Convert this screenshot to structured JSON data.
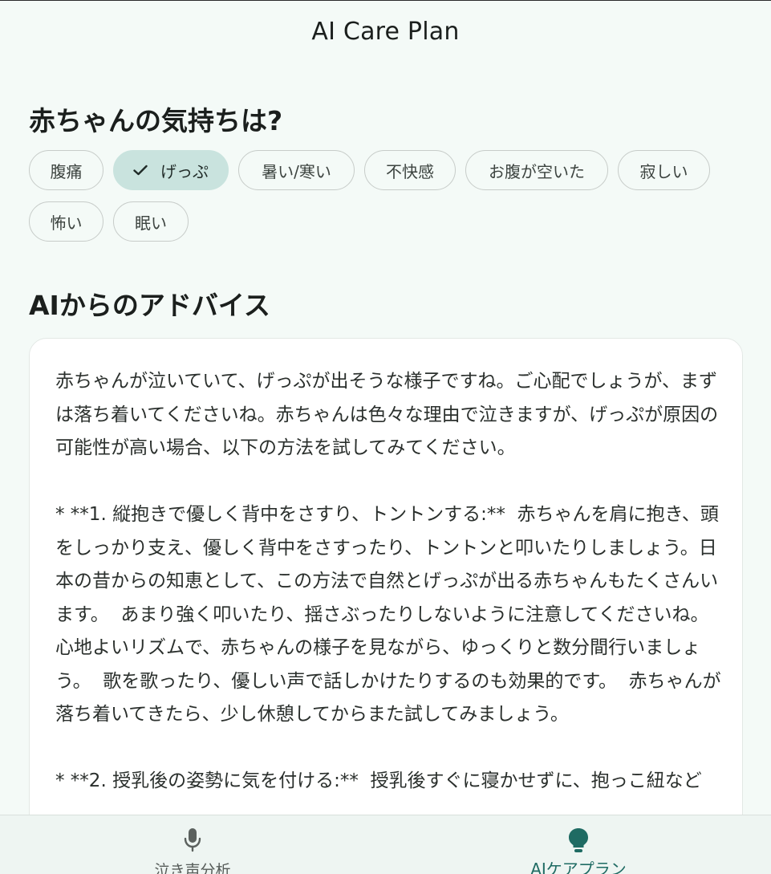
{
  "app": {
    "title": "AI Care Plan"
  },
  "feelings": {
    "title": "赤ちゃんの気持ちは?",
    "chips": [
      {
        "label": "腹痛",
        "selected": false
      },
      {
        "label": "げっぷ",
        "selected": true
      },
      {
        "label": "暑い/寒い",
        "selected": false
      },
      {
        "label": "不快感",
        "selected": false
      },
      {
        "label": "お腹が空いた",
        "selected": false
      },
      {
        "label": "寂しい",
        "selected": false
      },
      {
        "label": "怖い",
        "selected": false
      },
      {
        "label": "眠い",
        "selected": false
      }
    ]
  },
  "advice": {
    "title": "AIからのアドバイス",
    "text": "赤ちゃんが泣いていて、げっぷが出そうな様子ですね。ご心配でしょうが、まずは落ち着いてくださいね。赤ちゃんは色々な理由で泣きますが、げっぷが原因の可能性が高い場合、以下の方法を試してみてください。\n\n* **1. 縦抱きで優しく背中をさすり、トントンする:**  赤ちゃんを肩に抱き、頭をしっかり支え、優しく背中をさすったり、トントンと叩いたりしましょう。日本の昔からの知恵として、この方法で自然とげっぷが出る赤ちゃんもたくさんいます。  あまり強く叩いたり、揺さぶったりしないように注意してくださいね。  心地よいリズムで、赤ちゃんの様子を見ながら、ゆっくりと数分間行いましょう。  歌を歌ったり、優しい声で話しかけたりするのも効果的です。  赤ちゃんが落ち着いてきたら、少し休憩してからまた試してみましょう。\n\n* **2. 授乳後の姿勢に気を付ける:**  授乳後すぐに寝かせずに、抱っこ紐など"
  },
  "nav": {
    "items": [
      {
        "label": "泣き声分析",
        "icon": "microphone-icon",
        "active": false
      },
      {
        "label": "AIケアプラン",
        "icon": "lightbulb-icon",
        "active": true
      }
    ],
    "active_color": "#1f6b63"
  },
  "colors": {
    "background": "#f4faf7",
    "chip_selected": "#c9e3de",
    "accent": "#1f6b63"
  }
}
